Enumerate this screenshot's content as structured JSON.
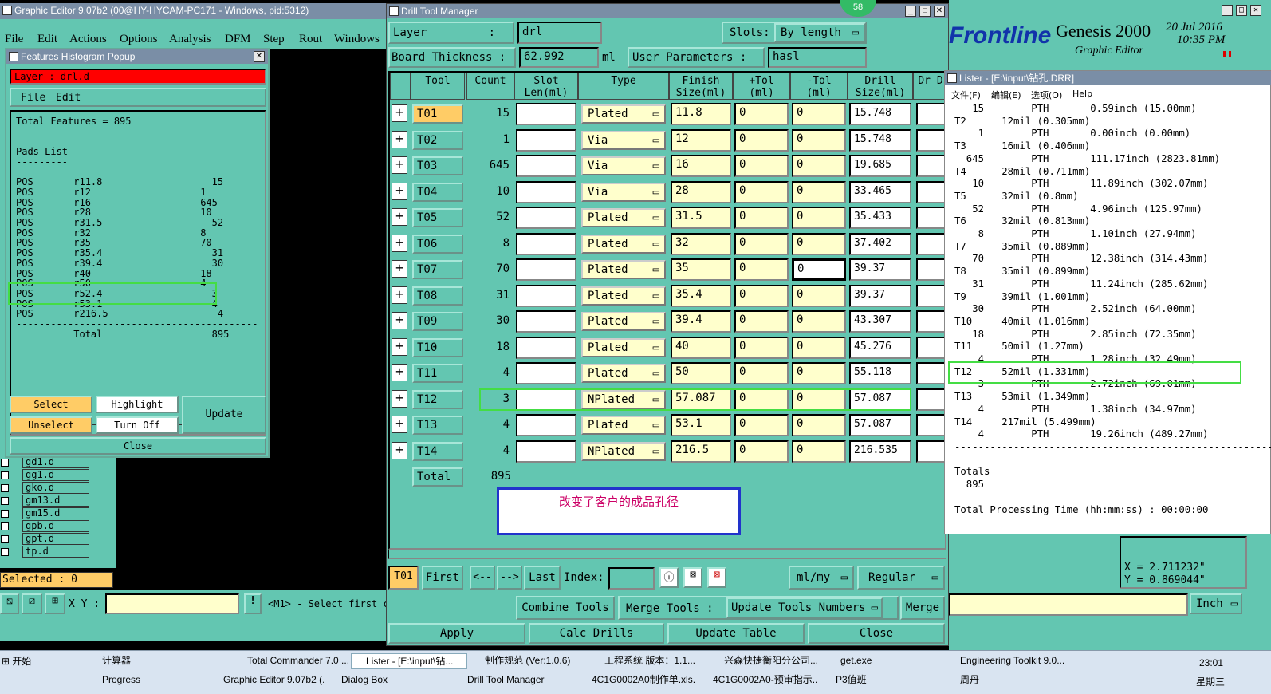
{
  "graphic_editor": {
    "title": "Graphic Editor 9.07b2 (00@HY-HYCAM-PC171 - Windows, pid:5312)",
    "menu": [
      "File",
      "Edit",
      "Actions",
      "Options",
      "Analysis",
      "DFM",
      "Step",
      "Rout",
      "Windows"
    ],
    "layers": [
      "gd1.d",
      "gg1.d",
      "gko.d",
      "gm13.d",
      "gm15.d",
      "gpb.d",
      "gpt.d",
      "tp.d"
    ],
    "selected": "Selected : 0",
    "xy_label": "X Y :",
    "prompt": "<M1> - Select first c"
  },
  "histogram": {
    "title": "Features Histogram Popup",
    "layer": "Layer : drl.d",
    "menu": [
      "File",
      "Edit"
    ],
    "total": "Total Features = 895",
    "pads_heading": "Pads List",
    "rule": "---------",
    "rows": [
      [
        "POS",
        "r11.8",
        "15"
      ],
      [
        "POS",
        "r12",
        "1"
      ],
      [
        "POS",
        "r16",
        "645"
      ],
      [
        "POS",
        "r28",
        "10"
      ],
      [
        "POS",
        "r31.5",
        "52"
      ],
      [
        "POS",
        "r32",
        "8"
      ],
      [
        "POS",
        "r35",
        "70"
      ],
      [
        "POS",
        "r35.4",
        "31"
      ],
      [
        "POS",
        "r39.4",
        "30"
      ],
      [
        "POS",
        "r40",
        "18"
      ],
      [
        "POS",
        "r50",
        "4"
      ],
      [
        "POS",
        "r52.4",
        "3"
      ],
      [
        "POS",
        "r53.1",
        "4"
      ],
      [
        "POS",
        "r216.5",
        "4"
      ]
    ],
    "total_label": "Total",
    "total_value": "895",
    "buttons": {
      "select": "Select",
      "highlight": "Highlight",
      "update": "Update",
      "unselect": "Unselect",
      "turn_off": "Turn Off",
      "close": "Close"
    }
  },
  "drill": {
    "title": "Drill Tool Manager",
    "layer_label": "Layer",
    "layer_value": "drl",
    "slots_label": "Slots:",
    "slots_value": "By length",
    "thickness_label": "Board Thickness :",
    "thickness_value": "62.992",
    "thickness_unit": "ml",
    "user_params_label": "User Parameters :",
    "user_params_value": "hasl",
    "headers": [
      "Tool",
      "Count",
      "Slot Len(ml)",
      "Type",
      "Finish Size(ml)",
      "+Tol (ml)",
      "-Tol (ml)",
      "Drill Size(ml)",
      "Dr D"
    ],
    "rows": [
      [
        "T01",
        "15",
        "Plated",
        "11.8",
        "0",
        "0",
        "15.748"
      ],
      [
        "T02",
        "1",
        "Via",
        "12",
        "0",
        "0",
        "15.748"
      ],
      [
        "T03",
        "645",
        "Via",
        "16",
        "0",
        "0",
        "19.685"
      ],
      [
        "T04",
        "10",
        "Via",
        "28",
        "0",
        "0",
        "33.465"
      ],
      [
        "T05",
        "52",
        "Plated",
        "31.5",
        "0",
        "0",
        "35.433"
      ],
      [
        "T06",
        "8",
        "Plated",
        "32",
        "0",
        "0",
        "37.402"
      ],
      [
        "T07",
        "70",
        "Plated",
        "35",
        "0",
        "0",
        "39.37"
      ],
      [
        "T08",
        "31",
        "Plated",
        "35.4",
        "0",
        "0",
        "39.37"
      ],
      [
        "T09",
        "30",
        "Plated",
        "39.4",
        "0",
        "0",
        "43.307"
      ],
      [
        "T10",
        "18",
        "Plated",
        "40",
        "0",
        "0",
        "45.276"
      ],
      [
        "T11",
        "4",
        "Plated",
        "50",
        "0",
        "0",
        "55.118"
      ],
      [
        "T12",
        "3",
        "NPlated",
        "57.087",
        "0",
        "0",
        "57.087"
      ],
      [
        "T13",
        "4",
        "Plated",
        "53.1",
        "0",
        "0",
        "57.087"
      ],
      [
        "T14",
        "4",
        "NPlated",
        "216.5",
        "0",
        "0",
        "216.535"
      ]
    ],
    "total_label": "Total",
    "total_value": "895",
    "annotation": "改变了客户的成品孔径",
    "nav": {
      "current": "T01",
      "first": "First",
      "prev": "<--",
      "next": "-->",
      "last": "Last",
      "index": "Index:",
      "units": "ml/my",
      "mode": "Regular"
    },
    "bottom": {
      "combine": "Combine Tools",
      "merge_tools": "Merge Tools :",
      "update_numbers": "Update Tools Numbers",
      "merge": "Merge",
      "apply": "Apply",
      "calc": "Calc Drills",
      "update_table": "Update Table",
      "close": "Close"
    },
    "badge": "58"
  },
  "genesis": {
    "logo": "Frontline",
    "product": "Genesis 2000",
    "sub": "Graphic Editor",
    "date": "20 Jul 2016",
    "time": "10:35 PM"
  },
  "lister": {
    "title": "Lister - [E:\\input\\钻孔.DRR]",
    "menu": [
      "文件(F)",
      "编辑(E)",
      "选项(O)",
      "Help"
    ],
    "lines": [
      "   15        PTH       0.59inch (15.00mm)",
      "T2      12mil (0.305mm)",
      "    1        PTH       0.00inch (0.00mm)",
      "T3      16mil (0.406mm)",
      "  645        PTH       111.17inch (2823.81mm)",
      "T4      28mil (0.711mm)",
      "   10        PTH       11.89inch (302.07mm)",
      "T5      32mil (0.8mm)",
      "   52        PTH       4.96inch (125.97mm)",
      "T6      32mil (0.813mm)",
      "    8        PTH       1.10inch (27.94mm)",
      "T7      35mil (0.889mm)",
      "   70        PTH       12.38inch (314.43mm)",
      "T8      35mil (0.899mm)",
      "   31        PTH       11.24inch (285.62mm)",
      "T9      39mil (1.001mm)",
      "   30        PTH       2.52inch (64.00mm)",
      "T10     40mil (1.016mm)",
      "   18        PTH       2.85inch (72.35mm)",
      "T11     50mil (1.27mm)",
      "    4        PTH       1.28inch (32.49mm)",
      "T12     52mil (1.331mm)",
      "    3        PTH       2.72inch (69.01mm)",
      "T13     53mil (1.349mm)",
      "    4        PTH       1.38inch (34.97mm)",
      "T14     217mil (5.499mm)",
      "    4        PTH       19.26inch (489.27mm)",
      "-----------------------------------------------------------",
      "",
      "Totals",
      "  895",
      "",
      "Total Processing Time (hh:mm:ss) : 00:00:00"
    ],
    "x": "X = 2.711232\"",
    "y": "Y = 0.869044\"",
    "unit": "Inch"
  },
  "taskbar": {
    "start": "开始",
    "row1": [
      "计算器",
      "Total Commander 7.0 ...",
      "Lister - [E:\\input\\钻...",
      "制作规范 (Ver:1.0.6)",
      "工程系统  版本：1.1...",
      "兴森快捷衡阳分公司...",
      "get.exe",
      "Engineering Toolkit 9.0..."
    ],
    "row2": [
      "Progress",
      "Graphic Editor 9.07b2 (...",
      "Dialog Box",
      "Drill Tool Manager",
      "4C1G0002A0制作单.xls...",
      "4C1G0002A0-预审指示...",
      "P3值班",
      "周丹"
    ],
    "clock": "23:01",
    "weekday": "星期三"
  }
}
